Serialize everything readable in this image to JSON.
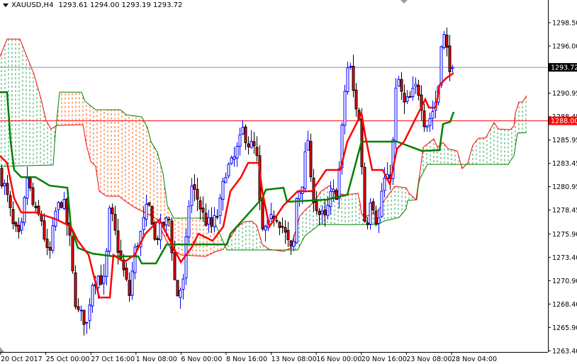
{
  "header": {
    "symbol": "XAUUSD,H4",
    "ohlc": "1293.61 1294.00 1293.19 1293.72"
  },
  "chart_data": {
    "type": "candlestick",
    "title": "XAUUSD,H4",
    "last_bar": {
      "open": 1293.61,
      "high": 1294.0,
      "low": 1293.19,
      "close": 1293.72
    },
    "ylim": [
      1263.4,
      1298.5
    ],
    "y_ticks": [
      1298.5,
      1296.0,
      1290.95,
      1288.45,
      1285.95,
      1283.45,
      1280.95,
      1278.45,
      1275.9,
      1273.4,
      1270.9,
      1268.4,
      1265.9,
      1263.4
    ],
    "x_ticks": [
      "20 Oct 2017",
      "25 Oct 00:00",
      "27 Oct 16:00",
      "1 Nov 08:00",
      "6 Nov 00:00",
      "8 Nov 16:00",
      "13 Nov 08:00",
      "16 Nov 00:00",
      "20 Nov 16:00",
      "23 Nov 08:00",
      "28 Nov 04:00"
    ],
    "bars_per_x_tick": 15.9,
    "bar_count": 160,
    "current_price": {
      "label": "1293.72",
      "value": 1293.72,
      "color": "#000000"
    },
    "level_line": {
      "label": "1288.00",
      "value": 1288.0,
      "color": "#ff0000"
    },
    "colors": {
      "bull": "#0000ff",
      "bear_body": "#ff0000",
      "tenkan": "#ff0000",
      "kijun": "#008000",
      "span_a": "#ff0000",
      "span_b": "#008000",
      "cloud_bull": "#2ca05a",
      "cloud_bear": "#ff5a00"
    },
    "close_path": [
      [
        0,
        1282.74
      ],
      [
        2.5,
        1280.47
      ],
      [
        5,
        1276.68
      ],
      [
        7.5,
        1275.16
      ],
      [
        10,
        1281.98
      ],
      [
        12.5,
        1278.2
      ],
      [
        15,
        1277.44
      ],
      [
        17.5,
        1272.89
      ],
      [
        20,
        1278.2
      ],
      [
        22.5,
        1279.71
      ],
      [
        25,
        1275.16
      ],
      [
        26.25,
        1270.62
      ],
      [
        27.5,
        1267.59
      ],
      [
        30,
        1266.83
      ],
      [
        31.25,
        1266.07
      ],
      [
        32.5,
        1270.62
      ],
      [
        35,
        1271.37
      ],
      [
        37.5,
        1270.62
      ],
      [
        38.75,
        1278.2
      ],
      [
        40,
        1277.44
      ],
      [
        42.5,
        1273.65
      ],
      [
        45,
        1270.62
      ],
      [
        46.25,
        1269.1
      ],
      [
        47.5,
        1273.65
      ],
      [
        50,
        1275.92
      ],
      [
        52.5,
        1278.95
      ],
      [
        53.75,
        1278.2
      ],
      [
        55,
        1275.16
      ],
      [
        57.5,
        1276.68
      ],
      [
        60,
        1277.44
      ],
      [
        61.25,
        1273.65
      ],
      [
        62.5,
        1269.1
      ],
      [
        63.75,
        1269.86
      ],
      [
        65,
        1270.62
      ],
      [
        66.25,
        1275.92
      ],
      [
        67.5,
        1281.22
      ],
      [
        70,
        1279.71
      ],
      [
        72.5,
        1277.44
      ],
      [
        75,
        1276.68
      ],
      [
        77.5,
        1278.2
      ],
      [
        80,
        1282.74
      ],
      [
        82.5,
        1283.5
      ],
      [
        85,
        1285.77
      ],
      [
        86.25,
        1287.28
      ],
      [
        87.5,
        1285.77
      ],
      [
        90,
        1285.01
      ],
      [
        91.25,
        1283.5
      ],
      [
        92.5,
        1275.92
      ],
      [
        95,
        1276.68
      ],
      [
        97.5,
        1278.2
      ],
      [
        100,
        1276.68
      ],
      [
        102.5,
        1274.4
      ],
      [
        103.75,
        1273.65
      ],
      [
        105,
        1279.71
      ],
      [
        107.5,
        1281.98
      ],
      [
        108.75,
        1287.28
      ],
      [
        110,
        1281.22
      ],
      [
        112.5,
        1278.2
      ],
      [
        115,
        1277.44
      ],
      [
        116.25,
        1278.95
      ],
      [
        117.5,
        1280.47
      ],
      [
        118.75,
        1279.71
      ],
      [
        120,
        1282.74
      ],
      [
        122.5,
        1293.34
      ],
      [
        123.75,
        1294.1
      ],
      [
        125,
        1291.07
      ],
      [
        127.5,
        1287.28
      ],
      [
        128.75,
        1277.44
      ],
      [
        130,
        1277.44
      ],
      [
        131.25,
        1280.47
      ],
      [
        132.5,
        1278.2
      ],
      [
        133.75,
        1276.68
      ],
      [
        135,
        1280.47
      ],
      [
        136.25,
        1281.98
      ],
      [
        137.5,
        1281.22
      ],
      [
        138.75,
        1284.25
      ],
      [
        140,
        1291.07
      ],
      [
        141.25,
        1292.59
      ],
      [
        142.5,
        1289.56
      ],
      [
        145,
        1290.31
      ],
      [
        146.25,
        1291.07
      ],
      [
        147.5,
        1291.83
      ],
      [
        148.75,
        1290.31
      ],
      [
        150,
        1288.04
      ],
      [
        151.25,
        1287.66
      ],
      [
        152.5,
        1288.8
      ],
      [
        153.75,
        1289.56
      ],
      [
        155,
        1291.83
      ],
      [
        156.25,
        1297.89
      ],
      [
        157.5,
        1296.37
      ],
      [
        158.75,
        1294.1
      ],
      [
        160,
        1293.72
      ]
    ],
    "tenkan_sen": [
      [
        0,
        1284.25
      ],
      [
        2.5,
        1283.5
      ],
      [
        5,
        1279.71
      ],
      [
        7.5,
        1278.2
      ],
      [
        12.5,
        1278.2
      ],
      [
        20,
        1277.44
      ],
      [
        25,
        1276.68
      ],
      [
        27.5,
        1275.16
      ],
      [
        31.25,
        1273.65
      ],
      [
        35,
        1269.1
      ],
      [
        38.75,
        1269.1
      ],
      [
        40,
        1273.65
      ],
      [
        43.75,
        1272.89
      ],
      [
        47.5,
        1273.65
      ],
      [
        51.25,
        1275.92
      ],
      [
        56.25,
        1277.44
      ],
      [
        60,
        1275.16
      ],
      [
        63.75,
        1272.89
      ],
      [
        67.5,
        1274.4
      ],
      [
        70,
        1275.92
      ],
      [
        75,
        1275.16
      ],
      [
        78.75,
        1276.68
      ],
      [
        81.25,
        1280.47
      ],
      [
        85,
        1281.98
      ],
      [
        87.5,
        1283.5
      ],
      [
        91.25,
        1283.5
      ],
      [
        92.5,
        1280.47
      ],
      [
        95,
        1276.68
      ],
      [
        100,
        1278.95
      ],
      [
        105,
        1280.47
      ],
      [
        110,
        1280.47
      ],
      [
        115,
        1282.74
      ],
      [
        120,
        1282.74
      ],
      [
        122.5,
        1285.77
      ],
      [
        125,
        1287.28
      ],
      [
        127.5,
        1288.8
      ],
      [
        128.75,
        1286.53
      ],
      [
        131.25,
        1282.74
      ],
      [
        135,
        1282.74
      ],
      [
        137.5,
        1281.22
      ],
      [
        140,
        1285.01
      ],
      [
        142.5,
        1285.77
      ],
      [
        147.5,
        1288.8
      ],
      [
        150,
        1290.31
      ],
      [
        151.25,
        1289.41
      ],
      [
        153.75,
        1289.41
      ],
      [
        155,
        1291.83
      ],
      [
        157.5,
        1292.59
      ],
      [
        160,
        1293.12
      ]
    ],
    "kijun_sen": [
      [
        0,
        1291.07
      ],
      [
        2.5,
        1291.07
      ],
      [
        3.75,
        1285.77
      ],
      [
        5,
        1282.74
      ],
      [
        7.5,
        1281.98
      ],
      [
        12.5,
        1281.98
      ],
      [
        17.5,
        1281.07
      ],
      [
        23.75,
        1280.84
      ],
      [
        25,
        1276.68
      ],
      [
        27.5,
        1274.4
      ],
      [
        32.5,
        1273.8
      ],
      [
        40,
        1273.5
      ],
      [
        48.75,
        1273.5
      ],
      [
        50,
        1272.74
      ],
      [
        55,
        1272.74
      ],
      [
        58.75,
        1274.78
      ],
      [
        80,
        1274.78
      ],
      [
        81.25,
        1275.92
      ],
      [
        92.5,
        1279.71
      ],
      [
        93.75,
        1280.62
      ],
      [
        100,
        1280.84
      ],
      [
        101.25,
        1279.33
      ],
      [
        115,
        1279.56
      ],
      [
        122.5,
        1280.09
      ],
      [
        127.5,
        1285.77
      ],
      [
        140,
        1285.77
      ],
      [
        148.75,
        1284.78
      ],
      [
        155,
        1284.86
      ],
      [
        156.25,
        1287.66
      ],
      [
        158.75,
        1287.89
      ],
      [
        160,
        1288.95
      ]
    ],
    "senkou_span_a": [
      [
        0,
        1294.86
      ],
      [
        2.5,
        1296.75
      ],
      [
        7,
        1296.75
      ],
      [
        9.5,
        1294.86
      ],
      [
        12,
        1292.97
      ],
      [
        14.5,
        1290.31
      ],
      [
        16.25,
        1288.04
      ],
      [
        18,
        1287.13
      ],
      [
        20,
        1287.51
      ],
      [
        29.25,
        1287.59
      ],
      [
        30.5,
        1285.39
      ],
      [
        32,
        1283.65
      ],
      [
        33.75,
        1283.12
      ],
      [
        35,
        1280.47
      ],
      [
        37.5,
        1279.94
      ],
      [
        42,
        1279.94
      ],
      [
        44.5,
        1279.33
      ],
      [
        47.5,
        1278.72
      ],
      [
        52.5,
        1277.97
      ],
      [
        55.5,
        1277.44
      ],
      [
        57.5,
        1275.92
      ],
      [
        60,
        1274.4
      ],
      [
        63.75,
        1273.65
      ],
      [
        72.5,
        1273.5
      ],
      [
        76.25,
        1274.03
      ],
      [
        78.75,
        1274.25
      ],
      [
        81.25,
        1275.54
      ],
      [
        83.75,
        1276.68
      ],
      [
        86.25,
        1277.21
      ],
      [
        88.75,
        1277.28
      ],
      [
        90.5,
        1276.83
      ],
      [
        92.5,
        1274.78
      ],
      [
        95,
        1274.25
      ],
      [
        100,
        1274.03
      ],
      [
        102.5,
        1274.4
      ],
      [
        105.75,
        1277.81
      ],
      [
        107.5,
        1278.42
      ],
      [
        110.75,
        1279.33
      ],
      [
        113.25,
        1280.47
      ],
      [
        116.25,
        1281.07
      ],
      [
        118.25,
        1280.24
      ],
      [
        121.75,
        1280.09
      ],
      [
        126.25,
        1280.24
      ],
      [
        127,
        1279.18
      ],
      [
        127.5,
        1278.04
      ],
      [
        129.25,
        1277.81
      ],
      [
        132.5,
        1278.2
      ],
      [
        133.75,
        1278.57
      ],
      [
        135.5,
        1279.48
      ],
      [
        139.25,
        1281.0
      ],
      [
        143.25,
        1280.84
      ],
      [
        144.25,
        1280.24
      ],
      [
        146.75,
        1279.56
      ],
      [
        147.5,
        1281.22
      ],
      [
        148.25,
        1282.74
      ],
      [
        149.25,
        1285.16
      ],
      [
        153,
        1286.07
      ],
      [
        154.25,
        1285.16
      ],
      [
        156.25,
        1285.69
      ],
      [
        158,
        1285.01
      ],
      [
        161.25,
        1284.78
      ],
      [
        163,
        1282.89
      ],
      [
        165,
        1283.5
      ],
      [
        166.75,
        1285.39
      ],
      [
        168.75,
        1286.15
      ],
      [
        171.25,
        1286.15
      ],
      [
        174.25,
        1287.81
      ],
      [
        175.75,
        1287.13
      ],
      [
        180,
        1287.06
      ],
      [
        181.25,
        1287.44
      ],
      [
        181.75,
        1288.8
      ],
      [
        183,
        1290.01
      ],
      [
        184.25,
        1290.01
      ],
      [
        185.75,
        1290.69
      ]
    ],
    "senkou_span_b": [
      [
        0,
        1283.12
      ],
      [
        18.75,
        1283.27
      ],
      [
        19.5,
        1286.53
      ],
      [
        21,
        1291.07
      ],
      [
        28.75,
        1291.07
      ],
      [
        30,
        1290.09
      ],
      [
        33.75,
        1289.18
      ],
      [
        42.5,
        1289.18
      ],
      [
        44.5,
        1288.65
      ],
      [
        50,
        1288.42
      ],
      [
        52,
        1287.28
      ],
      [
        53.25,
        1285.77
      ],
      [
        55.5,
        1284.63
      ],
      [
        57.5,
        1282.36
      ],
      [
        59,
        1278.95
      ],
      [
        61.25,
        1277.59
      ],
      [
        75,
        1277.59
      ],
      [
        77.5,
        1275.92
      ],
      [
        80,
        1274.18
      ],
      [
        105,
        1274.18
      ],
      [
        107.5,
        1275.69
      ],
      [
        111.75,
        1276.68
      ],
      [
        112.5,
        1276.9
      ],
      [
        133.25,
        1276.9
      ],
      [
        135.5,
        1277.28
      ],
      [
        140.75,
        1277.66
      ],
      [
        143.25,
        1278.57
      ],
      [
        143.75,
        1279.48
      ],
      [
        147,
        1279.56
      ],
      [
        147.5,
        1281.0
      ],
      [
        148,
        1281.75
      ],
      [
        150.75,
        1283.34
      ],
      [
        179.25,
        1283.34
      ],
      [
        180,
        1283.72
      ],
      [
        181.25,
        1284.25
      ],
      [
        181.75,
        1285.24
      ],
      [
        182.5,
        1286.68
      ],
      [
        185.75,
        1286.75
      ]
    ]
  }
}
